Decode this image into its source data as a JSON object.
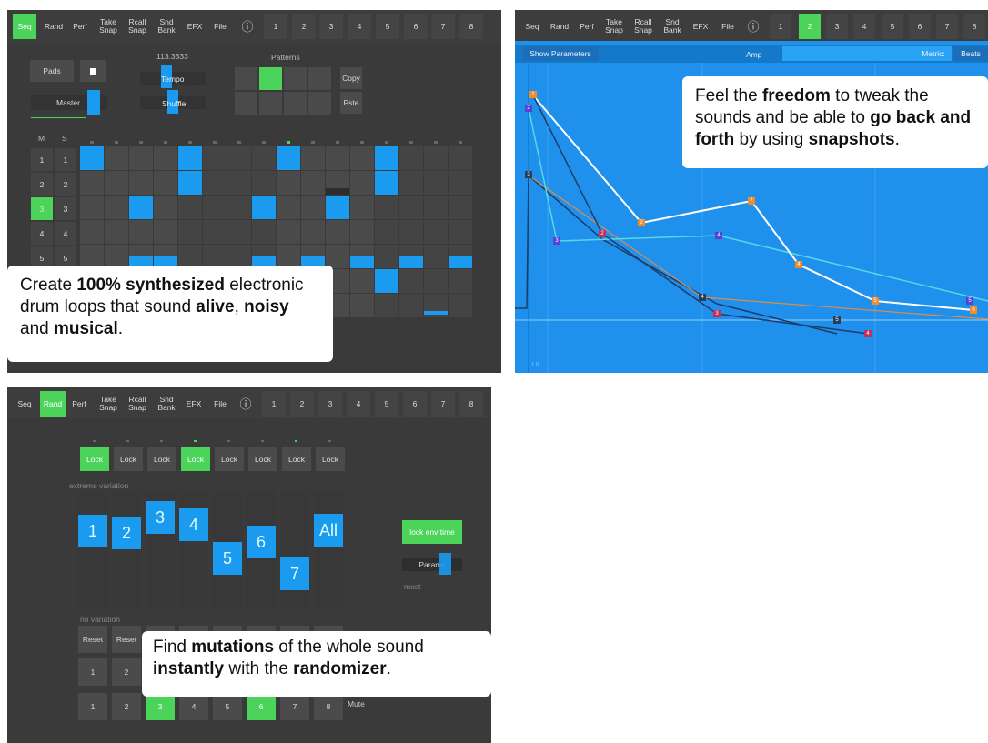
{
  "seq_panel": {
    "tabs": [
      {
        "label": "Seq",
        "active": true
      },
      {
        "label": "Rand",
        "active": false
      },
      {
        "label": "Perf",
        "active": false
      },
      {
        "label": "Take Snap",
        "active": false
      },
      {
        "label": "Rcall Snap",
        "active": false
      },
      {
        "label": "Snd Bank",
        "active": false
      },
      {
        "label": "EFX",
        "active": false
      },
      {
        "label": "File",
        "active": false
      }
    ],
    "info_icon": "info-icon",
    "pattern_numbers": [
      "1",
      "2",
      "3",
      "4",
      "5",
      "6",
      "7",
      "8"
    ],
    "pads_label": "Pads",
    "tempo_value": "113.3333",
    "tempo_label": "Tempo",
    "shuffle_label": "Shuffle",
    "master_label": "Master",
    "patterns_label": "Patterns",
    "copy_label": "Copy",
    "paste_label": "Pste",
    "m_label": "M",
    "s_label": "S",
    "track_rows": [
      [
        "1",
        "1"
      ],
      [
        "2",
        "2"
      ],
      [
        "3",
        "3"
      ],
      [
        "4",
        "4"
      ],
      [
        "5",
        "5"
      ]
    ],
    "active_mute_row": "3",
    "caption_parts": [
      "Create ",
      "100% synthesized",
      " electronic drum loops that sound ",
      "alive",
      ", ",
      "noisy",
      " and ",
      "musical",
      "."
    ]
  },
  "graph_panel": {
    "tabs": [
      "Seq",
      "Rand",
      "Perf",
      "Take Snap",
      "Rcall Snap",
      "Snd Bank",
      "EFX",
      "File"
    ],
    "pattern_numbers": [
      "1",
      "2",
      "3",
      "4",
      "5",
      "6",
      "7",
      "8"
    ],
    "active_pattern": "2",
    "show_params": "Show Parameters",
    "amp_label": "Amp",
    "metric_label": "Metric:",
    "beats_label": "Beats",
    "axis_label": "1.0",
    "caption_parts": [
      "Feel the ",
      "freedom",
      " to tweak the sounds and be able to ",
      "go back and forth",
      " by using ",
      "snapshots",
      "."
    ]
  },
  "rand_panel": {
    "tabs": [
      "Seq",
      "Rand",
      "Perf",
      "Take Snap",
      "Rcall Snap",
      "Snd Bank",
      "EFX",
      "File"
    ],
    "active_tab": "Rand",
    "pattern_numbers": [
      "1",
      "2",
      "3",
      "4",
      "5",
      "6",
      "7",
      "8"
    ],
    "lock_label": "Lock",
    "locks_active": [
      true,
      false,
      false,
      true,
      false,
      false,
      false,
      false
    ],
    "extreme_label": "extreme variation",
    "no_variation_label": "no variation",
    "slider_labels": [
      "1",
      "2",
      "3",
      "4",
      "5",
      "6",
      "7",
      "All"
    ],
    "slider_levels": [
      0.72,
      0.7,
      0.88,
      0.8,
      0.4,
      0.6,
      0.22,
      0.73
    ],
    "all_slider_level": 0.73,
    "lock_env_label": "lock env time",
    "params_label": "Params",
    "most_label": "most",
    "reset_label": "Reset",
    "row_a": [
      "1",
      "2"
    ],
    "row_b": [
      "1",
      "2",
      "3",
      "4",
      "5",
      "6",
      "7",
      "8"
    ],
    "row_b_active": [
      "3",
      "6"
    ],
    "mute_label": "Mute",
    "caption_parts": [
      "Find ",
      "mutations",
      " of the whole sound ",
      "instantly",
      " with the ",
      "randomizer",
      "."
    ]
  }
}
